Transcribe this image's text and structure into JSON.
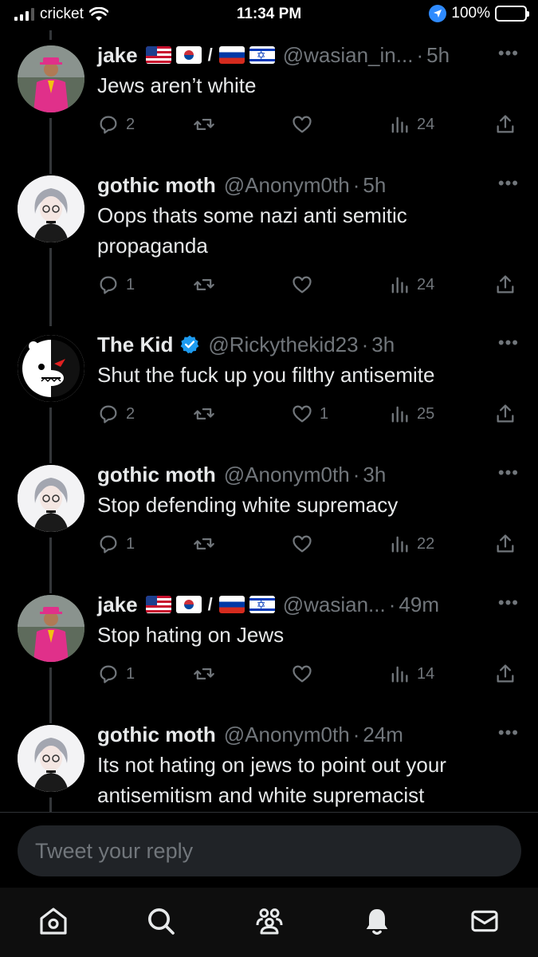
{
  "status_bar": {
    "carrier": "cricket",
    "time": "11:34 PM",
    "battery": "100%"
  },
  "tweets": [
    {
      "name": "jake",
      "flags": [
        "us-flag",
        "kr-flag",
        "ru-flag",
        "il-flag"
      ],
      "flag_separator": "/",
      "handle": "@wasian_in...",
      "time": "5h",
      "text": "Jews aren’t white",
      "replies": "2",
      "retweets": "",
      "likes": "",
      "views": "24"
    },
    {
      "name": "gothic moth",
      "handle": "@Anonym0th",
      "time": "5h",
      "text": "Oops thats some nazi anti semitic propaganda",
      "replies": "1",
      "retweets": "",
      "likes": "",
      "views": "24"
    },
    {
      "name": "The Kid",
      "verified": true,
      "handle": "@Rickythekid23",
      "time": "3h",
      "text": "Shut the fuck up you filthy antisemite",
      "replies": "2",
      "retweets": "",
      "likes": "1",
      "views": "25"
    },
    {
      "name": "gothic moth",
      "handle": "@Anonym0th",
      "time": "3h",
      "text": "Stop defending white supremacy",
      "replies": "1",
      "retweets": "",
      "likes": "",
      "views": "22"
    },
    {
      "name": "jake",
      "flags": [
        "us-flag",
        "kr-flag",
        "ru-flag",
        "il-flag"
      ],
      "flag_separator": "/",
      "handle": "@wasian...",
      "time": "49m",
      "text": "Stop hating on Jews",
      "replies": "1",
      "retweets": "",
      "likes": "",
      "views": "14"
    },
    {
      "name": "gothic moth",
      "handle": "@Anonym0th",
      "time": "24m",
      "text": "Its not hating on jews to point out your antisemitism and white supremacist"
    }
  ],
  "reply": {
    "placeholder": "Tweet your reply"
  },
  "bottom_nav": {
    "items": [
      "home-icon",
      "search-icon",
      "communities-icon",
      "notifications-icon",
      "messages-icon"
    ]
  },
  "colors": {
    "background": "#000000",
    "text": "#e7e9ea",
    "secondary": "#71767b",
    "verified": "#1d9bf0",
    "jake_suit": "#e0308a"
  }
}
